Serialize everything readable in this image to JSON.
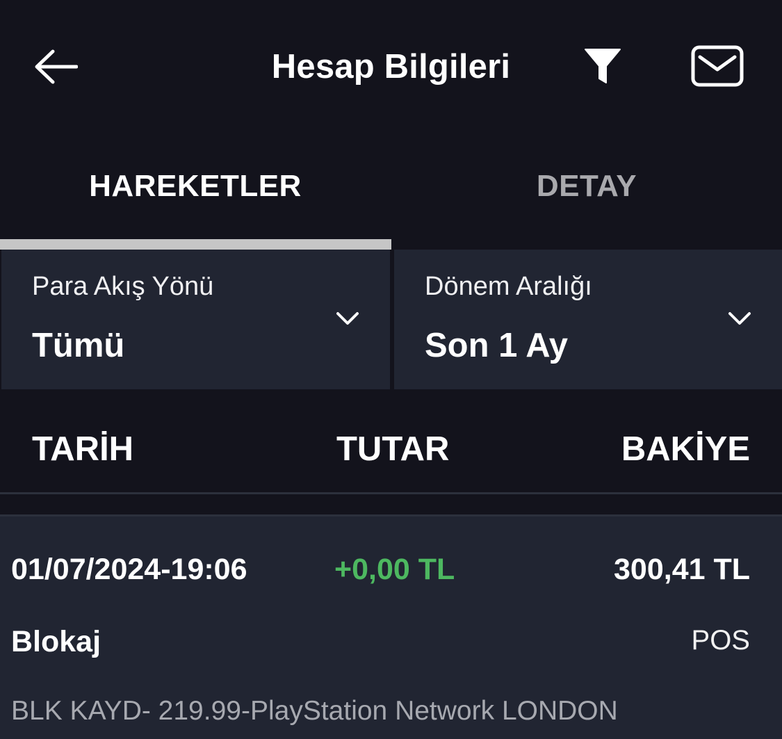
{
  "header": {
    "title": "Hesap Bilgileri",
    "back_icon": "arrow-left-icon",
    "filter_icon": "funnel-icon",
    "mail_icon": "envelope-icon"
  },
  "tabs": [
    {
      "label": "HAREKETLER",
      "active": true
    },
    {
      "label": "DETAY",
      "active": false
    }
  ],
  "filters": {
    "direction": {
      "label": "Para Akış Yönü",
      "value": "Tümü"
    },
    "period": {
      "label": "Dönem Aralığı",
      "value": "Son 1 Ay"
    }
  },
  "columns": {
    "date": "TARİH",
    "amount": "TUTAR",
    "balance": "BAKİYE"
  },
  "transactions": [
    {
      "date": "01/07/2024-19:06",
      "amount": "+0,00 TL",
      "balance": "300,41 TL",
      "type": "Blokaj",
      "channel": "POS",
      "description": "BLK KAYD- 219.99-PlayStation Network LONDON"
    }
  ],
  "colors": {
    "background": "#13131c",
    "panel": "#212532",
    "positive_amount": "#4db860",
    "tab_indicator": "#c6c6c6",
    "inactive_tab": "#a9a9ad"
  }
}
